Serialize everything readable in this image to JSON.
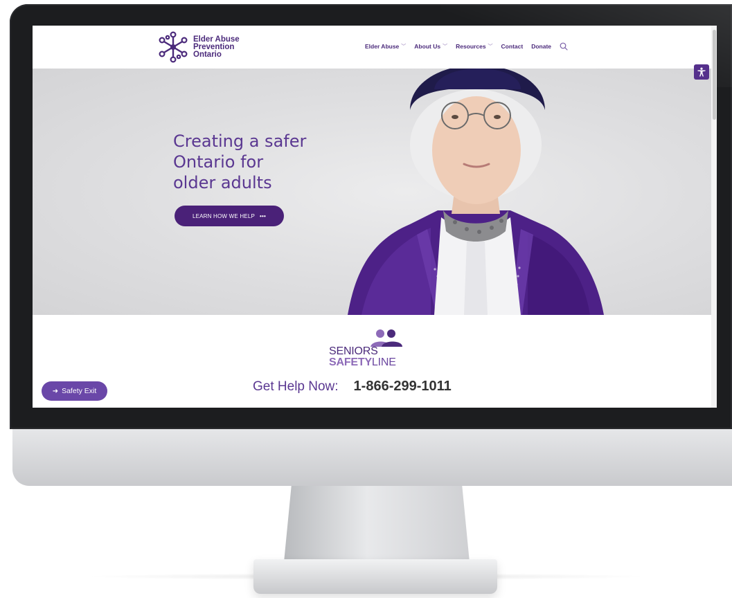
{
  "site": {
    "logo_lines": [
      "Elder Abuse",
      "Prevention",
      "Ontario"
    ]
  },
  "nav": {
    "items": [
      {
        "label": "Elder Abuse",
        "dropdown": true
      },
      {
        "label": "About Us",
        "dropdown": true
      },
      {
        "label": "Resources",
        "dropdown": true
      },
      {
        "label": "Contact",
        "dropdown": false
      },
      {
        "label": "Donate",
        "dropdown": false
      }
    ],
    "search_icon": "search-icon"
  },
  "hero": {
    "title_lines": [
      "Creating a safer",
      "Ontario for",
      "older adults"
    ],
    "cta_label": "LEARN HOW WE HELP",
    "cta_dots": "•••"
  },
  "helpline": {
    "logo_top": "SENIORS",
    "logo_bottom_a": "SAFETY",
    "logo_bottom_b": "LINE",
    "label": "Get Help Now:",
    "phone": "1-866-299-1011"
  },
  "safety_exit": {
    "label": "Safety Exit"
  },
  "colors": {
    "brand_purple": "#4b2a7b",
    "button_purple": "#4a2178",
    "accent_lavender": "#8d6ab8"
  }
}
